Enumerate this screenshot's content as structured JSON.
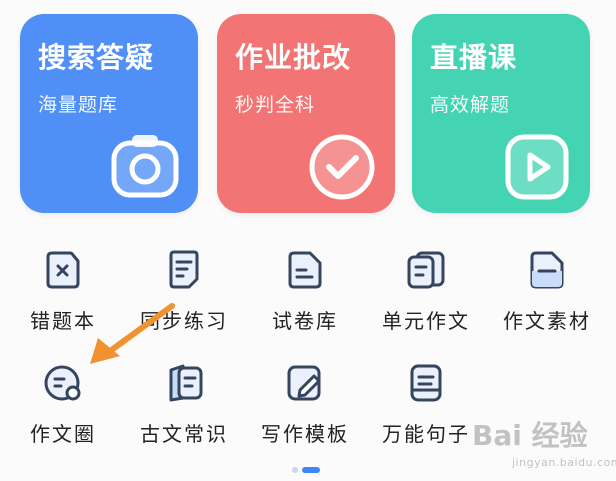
{
  "cards": [
    {
      "title": "搜索答疑",
      "subtitle": "海量题库",
      "icon": "camera-icon",
      "color": "#4f8ff6"
    },
    {
      "title": "作业批改",
      "subtitle": "秒判全科",
      "icon": "check-circle-icon",
      "color": "#f37474"
    },
    {
      "title": "直播课",
      "subtitle": "高效解题",
      "icon": "play-icon",
      "color": "#45d4b3"
    }
  ],
  "shortcuts": [
    {
      "label": "错题本",
      "icon": "wrong-book-icon"
    },
    {
      "label": "同步练习",
      "icon": "practice-icon"
    },
    {
      "label": "试卷库",
      "icon": "exam-paper-icon"
    },
    {
      "label": "单元作文",
      "icon": "unit-essay-icon"
    },
    {
      "label": "作文素材",
      "icon": "essay-material-icon"
    },
    {
      "label": "作文圈",
      "icon": "essay-circle-icon"
    },
    {
      "label": "古文常识",
      "icon": "classical-chinese-icon"
    },
    {
      "label": "写作模板",
      "icon": "writing-template-icon"
    },
    {
      "label": "万能句子",
      "icon": "sentence-icon"
    }
  ],
  "pager": {
    "pages": 2,
    "current": 2
  },
  "watermark": {
    "main": "Bai 经验",
    "sub": "jingyan.baidu.com"
  },
  "colors": {
    "icon_stroke": "#34455d",
    "icon_fill": "#eaf1fd",
    "pager_active": "#3d86f5",
    "arrow": "#f0922f"
  }
}
